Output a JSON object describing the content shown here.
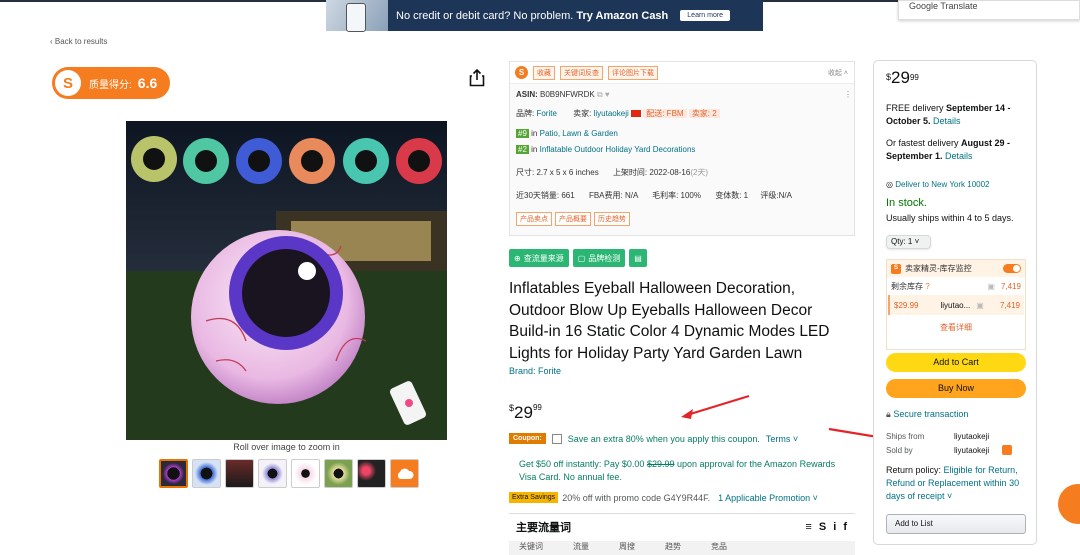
{
  "banner": {
    "text": "No credit or debit card? No problem.",
    "text_bold": "Try Amazon Cash",
    "button": "Learn more"
  },
  "google_translate": "Google Translate",
  "back_link": "‹ Back to results",
  "quality": {
    "label": "质量得分:",
    "score": "6.6"
  },
  "gallery": {
    "zoom_hint": "Roll over image to zoom in",
    "thumbnail_count": 8
  },
  "plugin": {
    "tabs": [
      "收藏",
      "关键词反查",
      "评论图片下载"
    ],
    "fold": "收起",
    "asin_label": "ASIN:",
    "asin": "B0B9NFWRDK",
    "brand_label": "品牌:",
    "brand": "Forite",
    "seller_label": "卖家:",
    "seller": "liyutaokeji",
    "fulfillment": "配送: FBM",
    "seller_count": "卖家: 2",
    "rank1_num": "#9",
    "rank1_in": "in",
    "rank1_cat": "Patio, Lawn & Garden",
    "rank2_num": "#2",
    "rank2_in": "in",
    "rank2_cat": "Inflatable Outdoor Holiday Yard Decorations",
    "size": "尺寸: 2.7 x 5 x 6 inches",
    "launch": "上架时间: 2022-08-16",
    "launch_days": "(2天)",
    "sales30": "近30天销量: 661",
    "fba": "FBA费用: N/A",
    "margin": "毛利率: 100%",
    "variants": "变体数: 1",
    "rating": "评级:N/A",
    "bottom_tags": [
      "产品卖点",
      "产品概要",
      "历史趋势"
    ]
  },
  "green_buttons": [
    "查流量来源",
    "品牌检测"
  ],
  "product": {
    "title": "Inflatables Eyeball Halloween Decoration, Outdoor Blow Up Eyeballs Halloween Decor Build-in 16 Static Color 4 Dynamic Modes LED Lights for Holiday Party Yard Garden Lawn",
    "brand_link": "Brand: Forite",
    "price_currency": "$",
    "price_whole": "29",
    "price_fraction": "99"
  },
  "coupon": {
    "tag": "Coupon:",
    "text": "Save an extra 80% when you apply this coupon.",
    "terms": "Terms ˅"
  },
  "promo": {
    "line_pre": "Get $50 off instantly: Pay $0.00",
    "strike": "$29.99",
    "line_post": "upon approval for the Amazon Rewards Visa Card. No annual fee."
  },
  "extra_savings": {
    "tag": "Extra Savings",
    "text": "20% off with promo code G4Y9R44F.",
    "link": "1 Applicable Promotion ˅"
  },
  "traffic_section": {
    "title": "主要流量词",
    "logo": "≡ S i f",
    "columns": [
      "关键词",
      "流量",
      "周搜",
      "趋势",
      "竞品"
    ]
  },
  "buybox": {
    "price_currency": "$",
    "price_whole": "29",
    "price_fraction": "99",
    "free_delivery_pre": "FREE delivery",
    "free_delivery_date": "September 14 - October 5.",
    "details": "Details",
    "fastest_pre": "Or fastest delivery",
    "fastest_date": "August 29 - September 1.",
    "deliver_to": "Deliver to New York 10002",
    "stock": "In stock.",
    "ships_within": "Usually ships within 4 to 5 days.",
    "qty": "Qty: 1 ˅",
    "inventory_title": "卖家精灵-库存监控",
    "remaining_label": "剩余库存",
    "remaining_value": "7,419",
    "seller_price": "$29.99",
    "seller_name": "liyutao...",
    "seller_stock": "7,419",
    "view_details": "查看详细",
    "add_to_cart": "Add to Cart",
    "buy_now": "Buy Now",
    "secure": "Secure transaction",
    "ships_from_label": "Ships from",
    "ships_from_value": "liyutaokeji",
    "sold_by_label": "Sold by",
    "sold_by_value": "liyutaokeji",
    "return_pre": "Return policy:",
    "return_link": "Eligible for Return, Refund or Replacement within 30 days of receipt ˅",
    "add_to_list": "Add to List"
  }
}
